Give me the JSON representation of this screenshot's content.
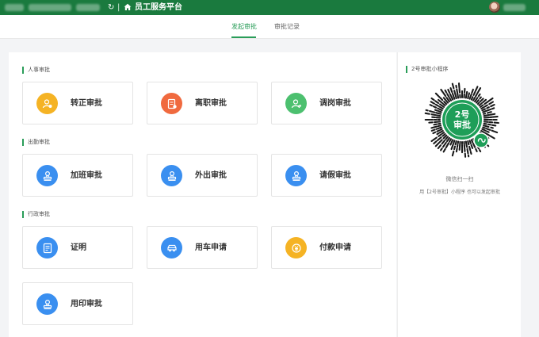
{
  "header": {
    "title": "员工服务平台"
  },
  "tabs": [
    {
      "label": "发起审批",
      "active": true
    },
    {
      "label": "审批记录",
      "active": false
    }
  ],
  "sections": [
    {
      "title": "人事审批",
      "cards": [
        {
          "label": "转正审批",
          "icon": "user-badge-icon",
          "color": "#f5b324"
        },
        {
          "label": "离职审批",
          "icon": "resign-doc-icon",
          "color": "#f06a3f"
        },
        {
          "label": "调岗审批",
          "icon": "user-transfer-icon",
          "color": "#4cc06f"
        }
      ]
    },
    {
      "title": "出勤审批",
      "cards": [
        {
          "label": "加班审批",
          "icon": "stamp-icon",
          "color": "#3a8ff0"
        },
        {
          "label": "外出审批",
          "icon": "stamp-icon",
          "color": "#3a8ff0"
        },
        {
          "label": "请假审批",
          "icon": "stamp-icon",
          "color": "#3a8ff0"
        }
      ]
    },
    {
      "title": "行政审批",
      "cards": [
        {
          "label": "证明",
          "icon": "certificate-icon",
          "color": "#3a8ff0"
        },
        {
          "label": "用车申请",
          "icon": "car-icon",
          "color": "#3a8ff0"
        },
        {
          "label": "付款申请",
          "icon": "payment-icon",
          "color": "#f5b324"
        },
        {
          "label": "用印审批",
          "icon": "stamp-icon",
          "color": "#3a8ff0"
        }
      ]
    }
  ],
  "side_panel": {
    "title": "2号审批小程序",
    "qr_text": [
      "2号",
      "审批"
    ],
    "caption1": "微信扫一扫",
    "caption2": "用【2号审批】小程序 也可以发起审批"
  }
}
